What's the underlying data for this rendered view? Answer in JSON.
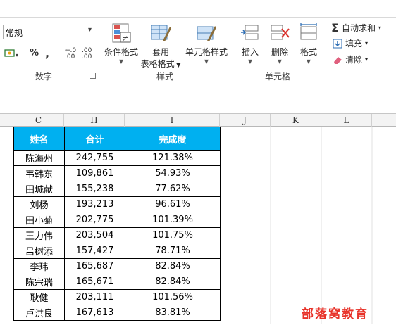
{
  "ribbon": {
    "number_group": {
      "label": "数字",
      "format_value": "常规",
      "percent": "%",
      "comma": ",",
      "inc_decimal": ".00",
      "dec_decimal": ".00"
    },
    "styles_group": {
      "label": "样式",
      "conditional": "条件格式",
      "table_line1": "套用",
      "table_line2": "表格格式",
      "cell_styles": "单元格样式"
    },
    "cells_group": {
      "label": "单元格",
      "insert": "插入",
      "delete": "删除",
      "format": "格式"
    },
    "editing_group": {
      "autosum": "自动求和",
      "fill": "填充",
      "clear": "清除"
    }
  },
  "columns": [
    "C",
    "H",
    "I",
    "J",
    "K",
    "L"
  ],
  "table": {
    "headers": [
      "姓名",
      "合计",
      "完成度"
    ],
    "rows": [
      [
        "陈海州",
        "242,755",
        "121.38%"
      ],
      [
        "韦韩东",
        "109,861",
        "54.93%"
      ],
      [
        "田城献",
        "155,238",
        "77.62%"
      ],
      [
        "刘杨",
        "193,213",
        "96.61%"
      ],
      [
        "田小菊",
        "202,775",
        "101.39%"
      ],
      [
        "王力伟",
        "203,504",
        "101.75%"
      ],
      [
        "吕树添",
        "157,427",
        "78.71%"
      ],
      [
        "李玮",
        "165,687",
        "82.84%"
      ],
      [
        "陈宗瑞",
        "165,671",
        "82.84%"
      ],
      [
        "耿健",
        "203,111",
        "101.56%"
      ],
      [
        "卢洪良",
        "167,613",
        "83.81%"
      ]
    ]
  },
  "watermark": "部落窝教育",
  "colors": {
    "header_fill": "#00b0f0",
    "header_text": "#ffffff",
    "watermark": "#e8332a"
  }
}
